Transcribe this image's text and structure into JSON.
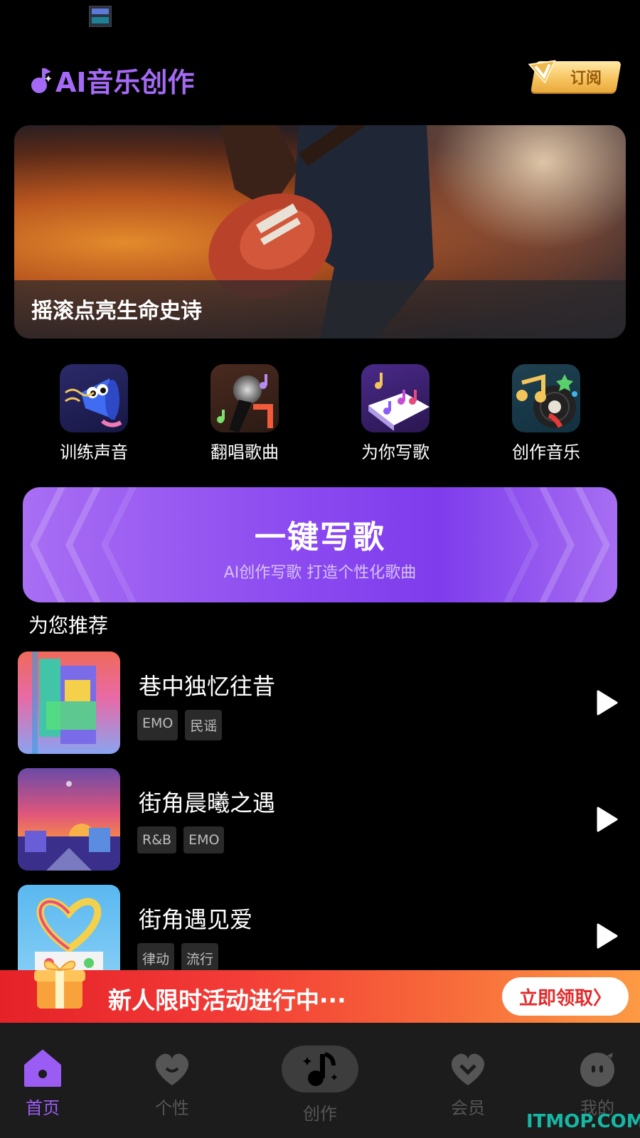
{
  "app": {
    "title": "AI音乐创作",
    "subscribe_label": "订阅"
  },
  "banner": {
    "caption": "摇滚点亮生命史诗"
  },
  "features": [
    {
      "label": "训练声音",
      "icon": "megaphone-icon"
    },
    {
      "label": "翻唱歌曲",
      "icon": "microphone-icon"
    },
    {
      "label": "为你写歌",
      "icon": "music-book-icon"
    },
    {
      "label": "创作音乐",
      "icon": "vinyl-icon"
    }
  ],
  "cta": {
    "title": "一键写歌",
    "subtitle": "AI创作写歌  打造个性化歌曲"
  },
  "recommend": {
    "heading": "为您推荐",
    "songs": [
      {
        "title": "巷中独忆往昔",
        "tags": [
          "EMO",
          "民谣"
        ]
      },
      {
        "title": "街角晨曦之遇",
        "tags": [
          "R&B",
          "EMO"
        ]
      },
      {
        "title": "街角遇见爱",
        "tags": [
          "律动",
          "流行"
        ]
      }
    ]
  },
  "promo": {
    "text": "新人限时活动进行中···",
    "button": "立即领取〉"
  },
  "nav": {
    "items": [
      {
        "label": "首页",
        "icon": "home-icon",
        "active": true
      },
      {
        "label": "个性",
        "icon": "heart-smile-icon",
        "active": false
      },
      {
        "label": "创作",
        "icon": "music-note-icon",
        "active": false
      },
      {
        "label": "会员",
        "icon": "vip-heart-icon",
        "active": false
      },
      {
        "label": "我的",
        "icon": "profile-face-icon",
        "active": false
      }
    ]
  },
  "watermark": "ITMOP.COM",
  "colors": {
    "accent": "#9b5cf4",
    "promo_red": "#e52228",
    "gold": "#f5c25c"
  }
}
